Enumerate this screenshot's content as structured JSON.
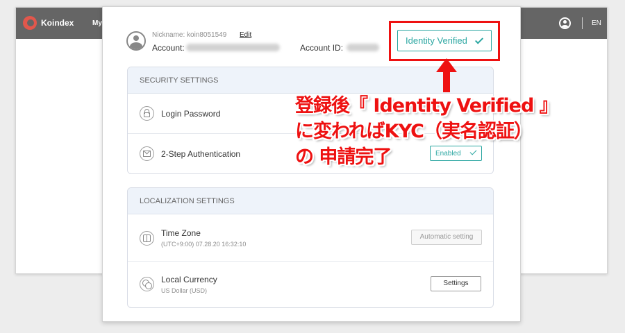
{
  "app": {
    "name": "Koindex",
    "nav_partial": "My",
    "language": "EN"
  },
  "profile": {
    "nickname": "Nickname: koin8051549",
    "edit_label": "Edit",
    "account_label": "Account:",
    "account_id_label": "Account ID:"
  },
  "identity": {
    "label": "Identity Verified",
    "icon": "check-icon"
  },
  "security": {
    "title": "SECURITY SETTINGS",
    "login_password": "Login Password",
    "two_step": "2-Step Authentication",
    "two_step_status": "Enabled"
  },
  "localization": {
    "title": "LOCALIZATION SETTINGS",
    "time_zone": "Time Zone",
    "time_zone_value": "(UTC+9:00) 07.28.20 16:32:10",
    "auto_setting_label": "Automatic setting",
    "currency": "Local Currency",
    "currency_value": "US Dollar (USD)",
    "settings_label": "Settings"
  },
  "annotation": {
    "line1": "登録後『 Identity Verified 』",
    "line2": "に変わればKYC（実名認証）",
    "line3": "の 申請完了",
    "color": "#ee1111"
  },
  "colors": {
    "accent": "#2aa6a1",
    "topbar": "#656565",
    "brand": "#e2574c"
  }
}
